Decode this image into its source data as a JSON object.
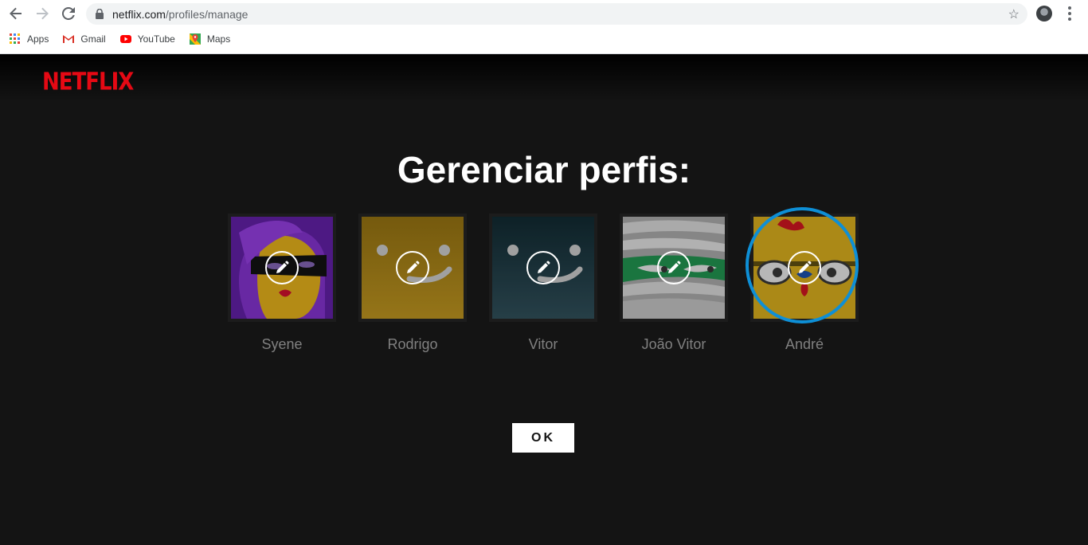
{
  "browser": {
    "url_host": "netflix.com",
    "url_path": "/profiles/manage",
    "bookmarks": [
      {
        "label": "Apps",
        "icon": "apps-grid-icon"
      },
      {
        "label": "Gmail",
        "icon": "gmail-icon"
      },
      {
        "label": "YouTube",
        "icon": "youtube-icon"
      },
      {
        "label": "Maps",
        "icon": "maps-icon"
      }
    ]
  },
  "page": {
    "logo": "NETFLIX",
    "title": "Gerenciar perfis:",
    "ok_label": "OK",
    "profiles": [
      {
        "name": "Syene",
        "avatar": "purple-masked-woman"
      },
      {
        "name": "Rodrigo",
        "avatar": "yellow-smiley"
      },
      {
        "name": "Vitor",
        "avatar": "teal-smiley"
      },
      {
        "name": "João Vitor",
        "avatar": "green-mummy"
      },
      {
        "name": "André",
        "avatar": "yellow-chicken",
        "highlighted": true
      }
    ]
  },
  "colors": {
    "netflix_red": "#e50914",
    "background": "#141414",
    "highlight_ring": "#0e8fd6"
  }
}
